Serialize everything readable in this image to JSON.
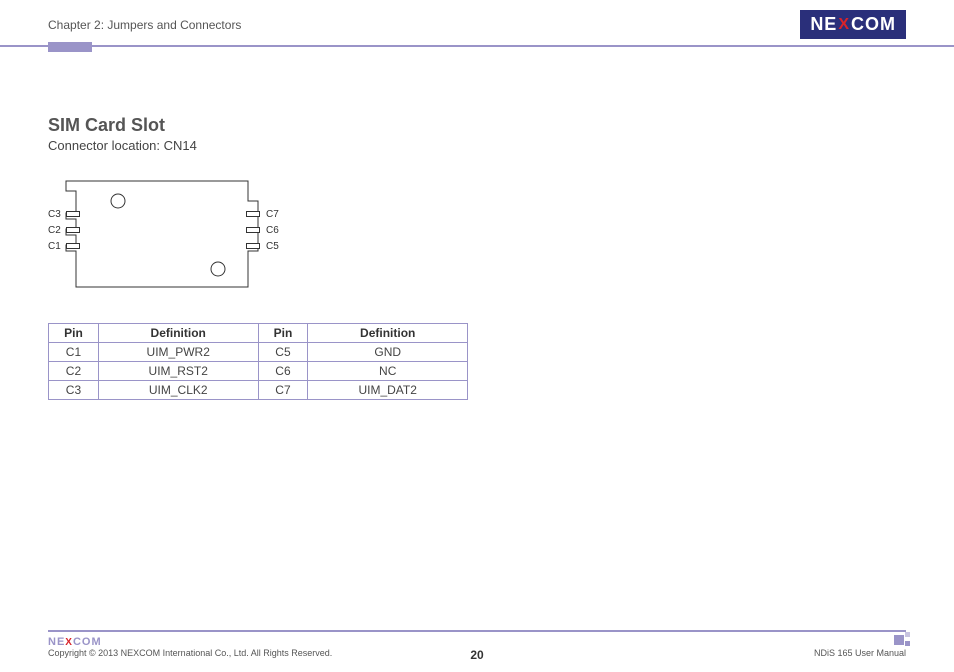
{
  "header": {
    "chapter": "Chapter 2: Jumpers and Connectors",
    "logo_parts": {
      "pre": "NE",
      "x": "X",
      "post": "COM"
    }
  },
  "main": {
    "title": "SIM Card Slot",
    "subtitle": "Connector location: CN14",
    "diagram_labels": {
      "left": [
        "C3",
        "C2",
        "C1"
      ],
      "right": [
        "C7",
        "C6",
        "C5"
      ]
    }
  },
  "table": {
    "headers": [
      "Pin",
      "Definition",
      "Pin",
      "Definition"
    ],
    "rows": [
      [
        "C1",
        "UIM_PWR2",
        "C5",
        "GND"
      ],
      [
        "C2",
        "UIM_RST2",
        "C6",
        "NC"
      ],
      [
        "C3",
        "UIM_CLK2",
        "C7",
        "UIM_DAT2"
      ]
    ]
  },
  "footer": {
    "logo_parts": {
      "pre": "NE",
      "x": "X",
      "post": "COM"
    },
    "copyright": "Copyright © 2013 NEXCOM International Co., Ltd. All Rights Reserved.",
    "page": "20",
    "manual": "NDiS 165 User Manual"
  }
}
